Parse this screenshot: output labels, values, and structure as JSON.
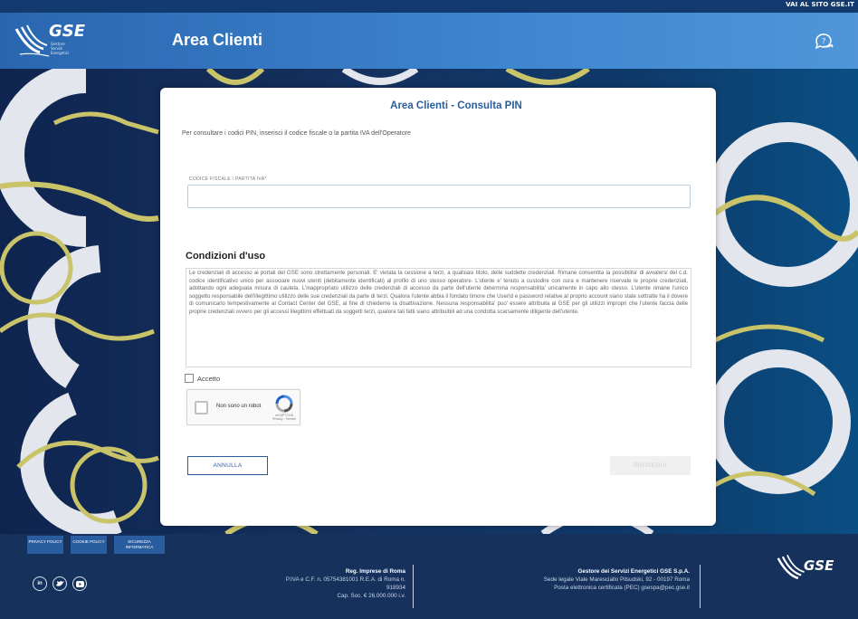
{
  "top_bar": {
    "visit_link": "VAI AL SITO GSE.IT"
  },
  "header": {
    "logo_text": "GSE",
    "logo_sub": "Gestore Servizi Energetici",
    "title": "Area Clienti"
  },
  "card": {
    "title": "Area Clienti - Consulta PIN",
    "intro": "Per consultare i codici PIN, inserisci il codice fiscale o la partita IVA dell'Operatore",
    "field_label": "CODICE FISCALE \\ PARTITA IVA*",
    "field_value": "",
    "conditions_title": "Condizioni d'uso",
    "conditions_text": "Le credenziali di accesso ai portali del GSE sono strettamente personali. E' vietata la cessione a terzi, a qualsiasi titolo, delle suddette credenziali. Rimane consentita la possibilita' di avvalersi del c.d. codice identificativo unico per associare nuovi utenti (debitamente identificati) al profilo di uno stesso operatore. L'utente e' tenuto a custodire con cura e mantenere riservate le proprie credenziali, adottando ogni adeguata misura di cautela. L'inappropriato utilizzo delle credenziali di accesso da parte dell'utente determina responsabilita' unicamente in capo allo stesso. L'utente rimane l'unico soggetto responsabile dell'illegittimo utilizzo delle sue credenziali da parte di terzi. Qualora l'utente abbia il fondato timore che UserId e password relative al proprio account siano state sottratte ha il dovere di comunicarlo tempestivamente al Contact Center del GSE, al fine di chiederne la disattivazione. Nessuna responsabilita' puo' essere attribuita al GSE per gli utilizzi impropri che l'utente faccia delle proprie credenziali ovvero per gli accessi illegittimi effettuati da soggetti terzi, qualora tali fatti siano attribuibili ad una condotta scarsamente diligente dell'utente.",
    "accept_label": "Accetto",
    "captcha_label": "Non sono un robot",
    "captcha_brand": "reCAPTCHA",
    "captcha_links": "Privacy - Termini",
    "cancel_button": "ANNULLA",
    "proceed_button": "PROSEGUI"
  },
  "footer": {
    "links": [
      "PRIVACY POLICY",
      "COOKIE POLICY",
      "SICUREZZA INFORMATICA"
    ],
    "social": [
      "in",
      "t",
      "yt"
    ],
    "registry_title": "Reg. Imprese di Roma",
    "registry_line1": "P.IVA e C.F. n. 05754381001 R.E.A. di Roma n.",
    "registry_line2": "918934",
    "registry_line3": "Cap. Soc. € 26.000.000 i.v.",
    "company_title": "Gestore dei Servizi Energetici GSE S.p.A.",
    "company_line1": "Sede legale Viale Maresciallo Pilsudski, 92 - 00197 Roma",
    "company_line2": "Posta elettronica certificata (PEC) gsespa@pec.gse.it",
    "logo_text": "GSE"
  },
  "colors": {
    "header_blue": "#3e86cf",
    "accent_blue": "#2a5d9f",
    "footer_navy": "#15315c",
    "gear_white": "#e3e6ec",
    "gear_yellow": "#c9c46a"
  }
}
